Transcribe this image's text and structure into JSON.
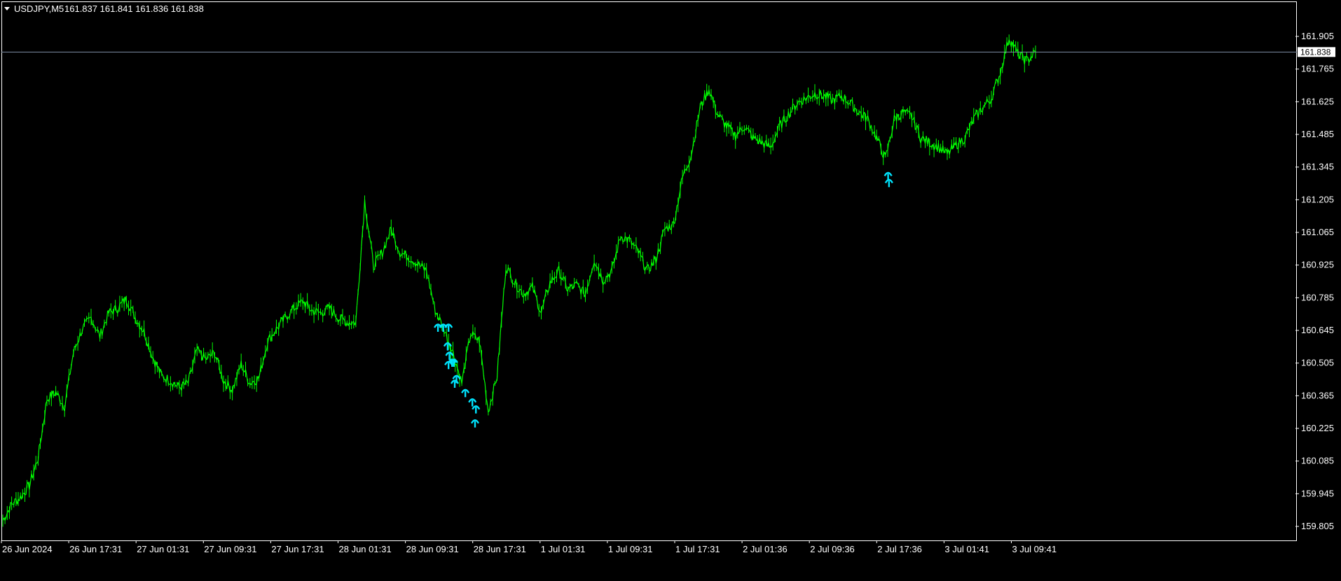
{
  "header": {
    "symbol": "USDJPY,M5",
    "ohlc": "161.837 161.841 161.836 161.838"
  },
  "colors": {
    "background": "#000000",
    "frame": "#ffffff",
    "price_line": "#00ff00",
    "current_price_line": "#7f8fa6",
    "markers": "#00e5ff"
  },
  "icons": {
    "menu": "triangle-down-icon",
    "marker": "arrow-up-icon"
  },
  "current_price": {
    "label": "161.838",
    "value": 161.838
  },
  "chart_data": {
    "type": "line",
    "title": "",
    "xlabel": "",
    "ylabel": "",
    "ylim": [
      159.75,
      161.95
    ],
    "grid": false,
    "x_tick_labels": [
      "26 Jun 2024",
      "26 Jun 17:31",
      "27 Jun 01:31",
      "27 Jun 09:31",
      "27 Jun 17:31",
      "28 Jun 01:31",
      "28 Jun 09:31",
      "28 Jun 17:31",
      "1 Jul 01:31",
      "1 Jul 09:31",
      "1 Jul 17:31",
      "2 Jul 01:36",
      "2 Jul 09:36",
      "2 Jul 17:36",
      "3 Jul 01:41",
      "3 Jul 09:41"
    ],
    "y_tick_labels": [
      "161.905",
      "161.765",
      "161.625",
      "161.485",
      "161.345",
      "161.205",
      "161.065",
      "160.925",
      "160.785",
      "160.645",
      "160.505",
      "160.365",
      "160.225",
      "160.085",
      "159.945",
      "159.805"
    ],
    "y_ticks": [
      161.905,
      161.765,
      161.625,
      161.485,
      161.345,
      161.205,
      161.065,
      160.925,
      160.785,
      160.645,
      160.505,
      160.365,
      160.225,
      160.085,
      159.945,
      159.805
    ],
    "series": [
      {
        "values": [
          159.83,
          159.9,
          159.93,
          159.98,
          160.1,
          160.35,
          160.38,
          160.32,
          160.55,
          160.65,
          160.7,
          160.62,
          160.72,
          160.74,
          160.78,
          160.7,
          160.64,
          160.53,
          160.45,
          160.43,
          160.4,
          160.42,
          160.56,
          160.52,
          160.55,
          160.43,
          160.39,
          160.5,
          160.42,
          160.44,
          160.6,
          160.65,
          160.7,
          160.74,
          160.77,
          160.73,
          160.72,
          160.74,
          160.7,
          160.68,
          160.68,
          161.2,
          160.92,
          160.98,
          161.08,
          160.98,
          160.96,
          160.93,
          160.9,
          160.73,
          160.65,
          160.55,
          160.42,
          160.63,
          160.6,
          160.3,
          160.45,
          160.92,
          160.85,
          160.8,
          160.83,
          160.72,
          160.85,
          160.9,
          160.82,
          160.84,
          160.8,
          160.95,
          160.86,
          160.9,
          161.05,
          161.03,
          160.98,
          160.9,
          160.95,
          161.08,
          161.1,
          161.3,
          161.4,
          161.6,
          161.68,
          161.57,
          161.52,
          161.48,
          161.52,
          161.47,
          161.45,
          161.43,
          161.52,
          161.57,
          161.62,
          161.64,
          161.66,
          161.65,
          161.63,
          161.65,
          161.62,
          161.58,
          161.55,
          161.47,
          161.38,
          161.55,
          161.58,
          161.56,
          161.47,
          161.45,
          161.43,
          161.4,
          161.44,
          161.47,
          161.55,
          161.6,
          161.64,
          161.75,
          161.9,
          161.83,
          161.8,
          161.838
        ]
      }
    ],
    "markers": [
      {
        "x_index": 49.3,
        "value": 160.66
      },
      {
        "x_index": 49.9,
        "value": 160.66
      },
      {
        "x_index": 50.5,
        "value": 160.66
      },
      {
        "x_index": 50.4,
        "value": 160.58
      },
      {
        "x_index": 50.6,
        "value": 160.54
      },
      {
        "x_index": 50.9,
        "value": 160.51
      },
      {
        "x_index": 50.5,
        "value": 160.5
      },
      {
        "x_index": 51.1,
        "value": 160.51
      },
      {
        "x_index": 51.4,
        "value": 160.44
      },
      {
        "x_index": 51.2,
        "value": 160.42
      },
      {
        "x_index": 52.4,
        "value": 160.38
      },
      {
        "x_index": 53.2,
        "value": 160.34
      },
      {
        "x_index": 53.6,
        "value": 160.31
      },
      {
        "x_index": 53.5,
        "value": 160.25
      },
      {
        "x_index": 100.3,
        "value": 161.31
      },
      {
        "x_index": 100.4,
        "value": 161.28
      }
    ]
  }
}
